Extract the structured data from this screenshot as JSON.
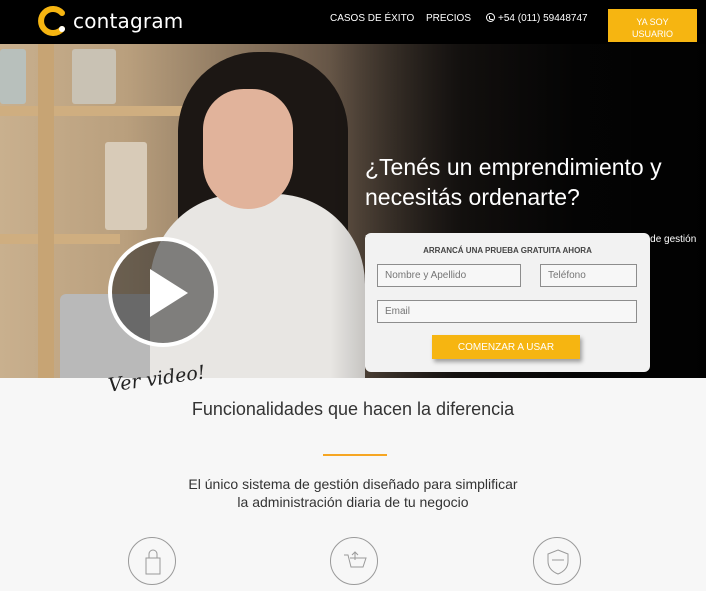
{
  "brand": {
    "name": "contagram",
    "accent": "#f6b511",
    "logo_colors": [
      "#f6b511",
      "#ffffff"
    ]
  },
  "nav": {
    "links": [
      "CASOS DE ÉXITO",
      "PRECIOS"
    ],
    "phone": "+54 (011) 59448747",
    "login_line1": "YA SOY",
    "login_line2": "USUARIO"
  },
  "hero": {
    "title": "¿Tenés un emprendimiento y necesitás ordenarte?",
    "subtitle": "Para facilitar la administración de tu empresa, utilizá un sistema de gestión simple, rápido e intuitivo",
    "video_label": "Ver video!"
  },
  "signup": {
    "heading": "ARRANCÁ UNA PRUEBA GRATUITA AHORA",
    "name_placeholder": "Nombre y Apellido",
    "phone_placeholder": "Teléfono",
    "email_placeholder": "Email",
    "submit_label": "COMENZAR A USAR"
  },
  "features": {
    "title": "Funcionalidades que hacen la diferencia",
    "description_line1": "El único sistema de gestión diseñado para simplificar",
    "description_line2": "la administración diaria de tu negocio",
    "icons": [
      "shopping-bag-icon",
      "cart-icon",
      "shield-icon"
    ]
  }
}
